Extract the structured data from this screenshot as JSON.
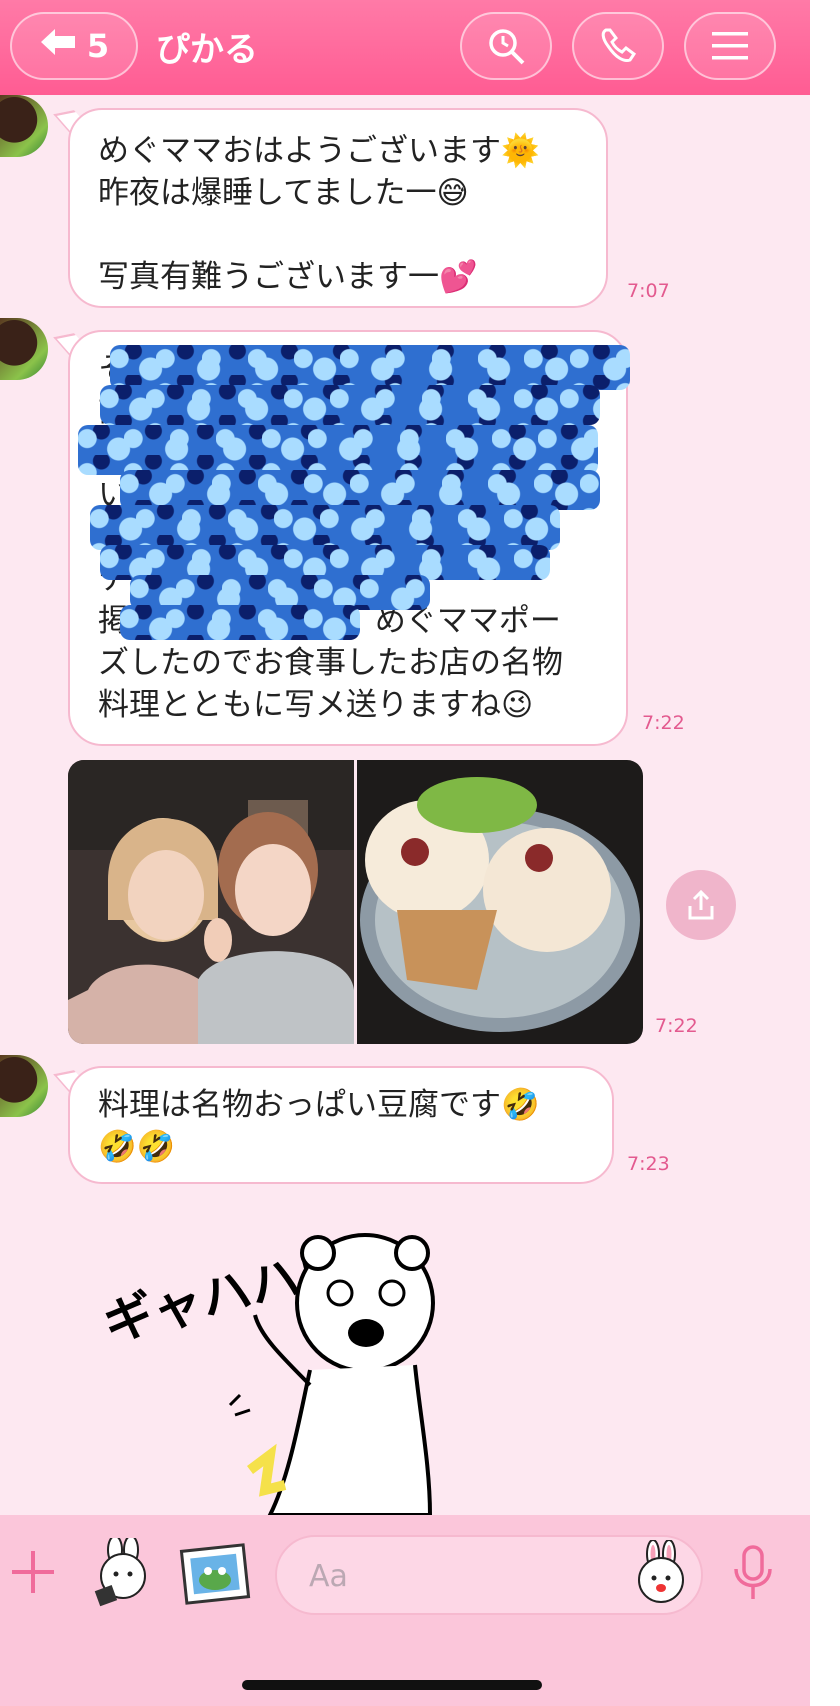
{
  "header": {
    "back_count": "5",
    "title": "ぴかる"
  },
  "messages": [
    {
      "lines": [
        "めぐママおはようございます🌞",
        "昨夜は爆睡してました一😅",
        "",
        "写真有難うございます一💕"
      ],
      "time": "7:07"
    },
    {
      "lines": [
        "そ",
        "前",
        "日",
        "い",
        "さ",
        "テ",
        "掲　　　　　　ず、めぐママポー",
        "ズしたのでお食事したお店の名物",
        "料理とともに写メ送りますね😉"
      ],
      "time": "7:22"
    },
    {
      "type": "photos",
      "time": "7:22"
    },
    {
      "lines": [
        "料理は名物おっぱい豆腐です🤣",
        "🤣🤣"
      ],
      "time": "7:23"
    }
  ],
  "sticker": {
    "text": "ギャハハ!!"
  },
  "input": {
    "placeholder": "Aa"
  },
  "colors": {
    "accent": "#ff5c93",
    "bubble_border": "#f6b9cf",
    "time": "#e35a8f",
    "background": "#fde8f1"
  }
}
